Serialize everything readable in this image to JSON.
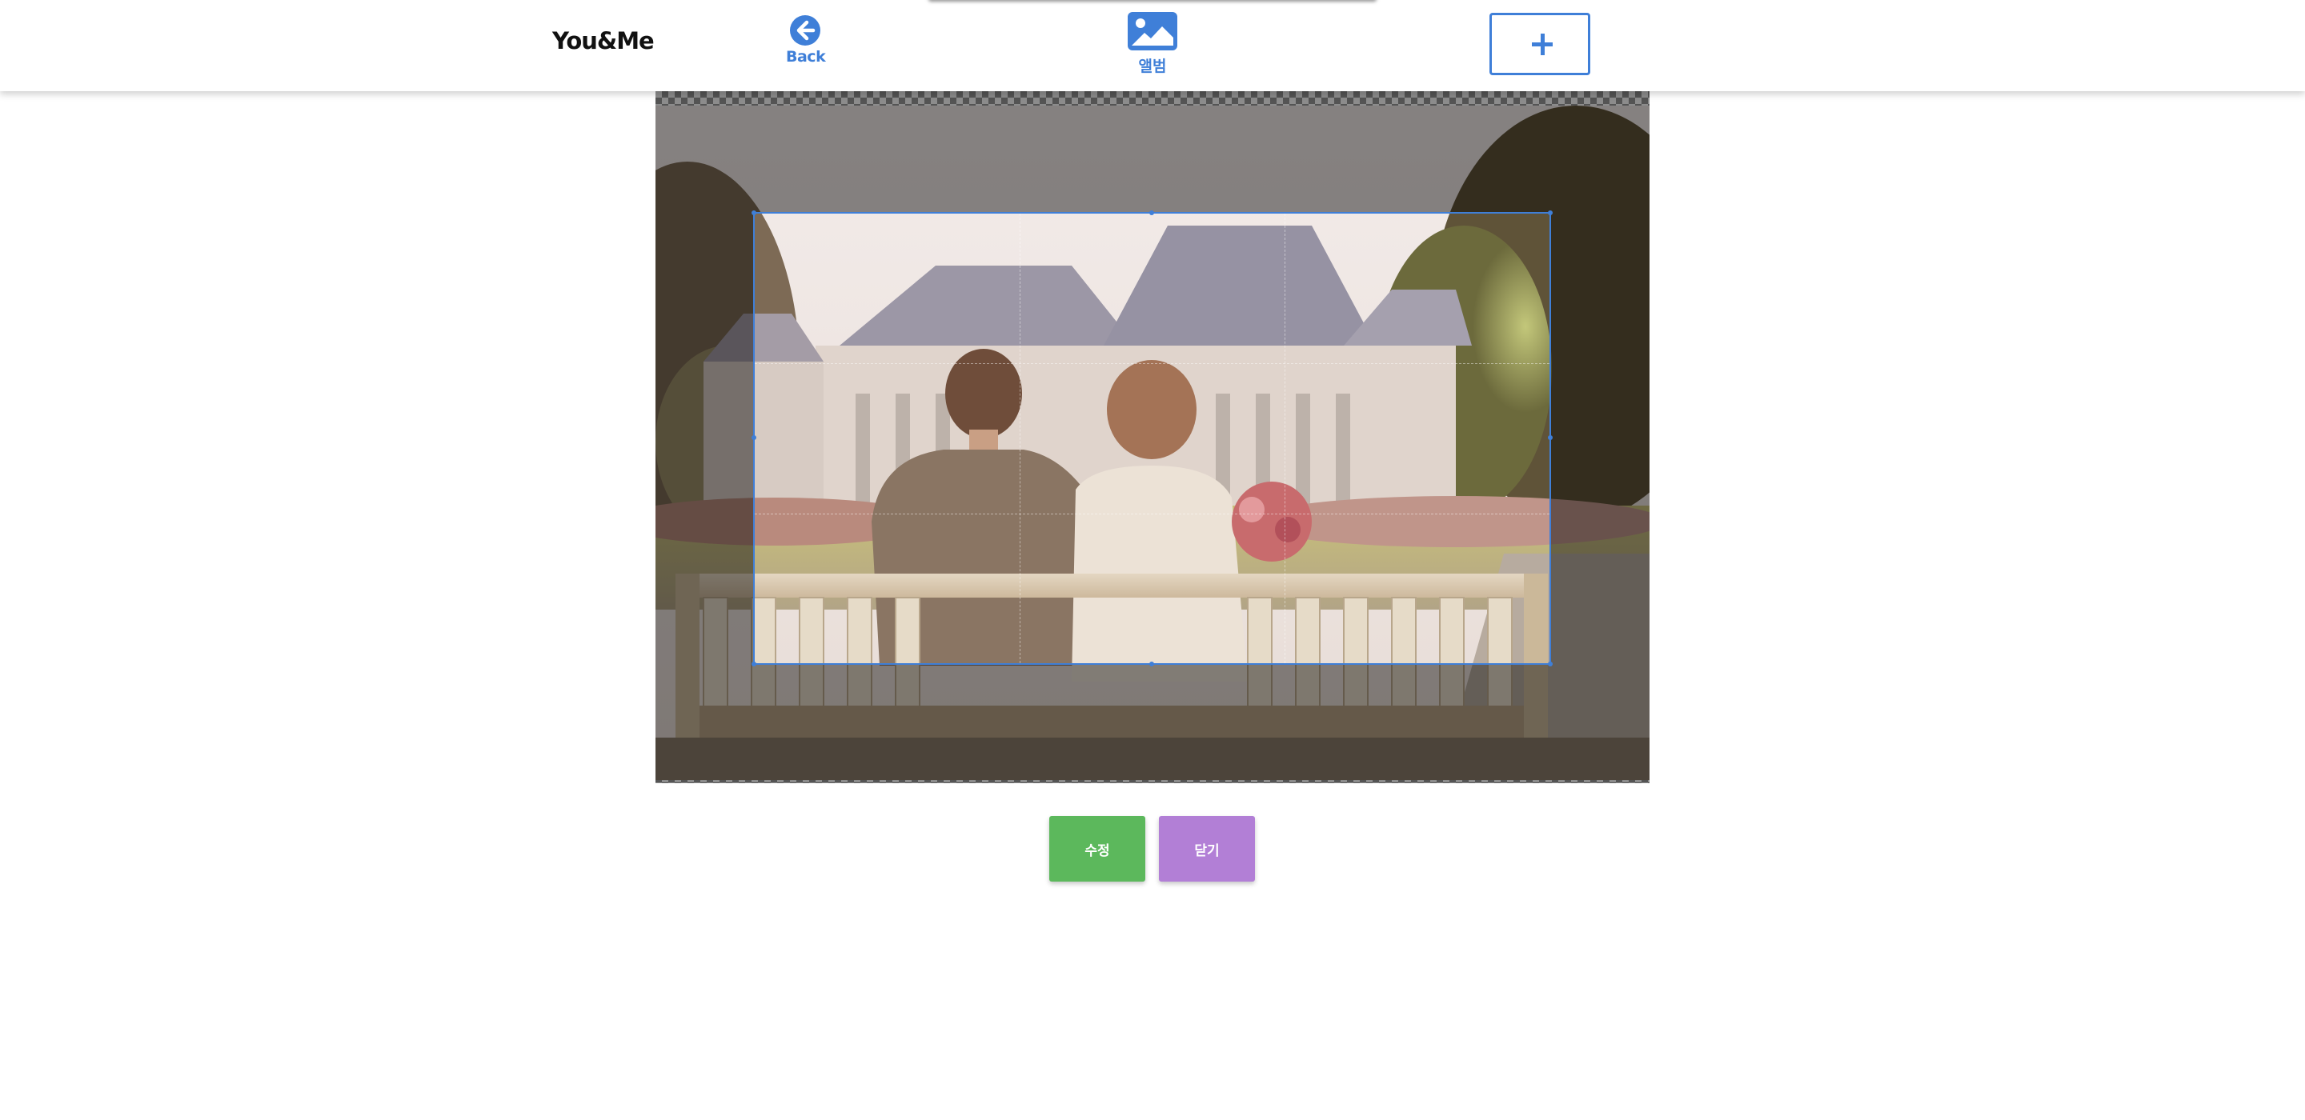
{
  "header": {
    "logo": "You&Me",
    "back_label": "Back",
    "album_label": "앨범",
    "add_icon": "plus-icon"
  },
  "cropper": {
    "image_desc_icon": "photo-image"
  },
  "actions": {
    "edit_label": "수정",
    "close_label": "닫기"
  },
  "colors": {
    "accent": "#3f7fd8",
    "edit_button": "#5cb85c",
    "close_button": "#b27fd6"
  }
}
